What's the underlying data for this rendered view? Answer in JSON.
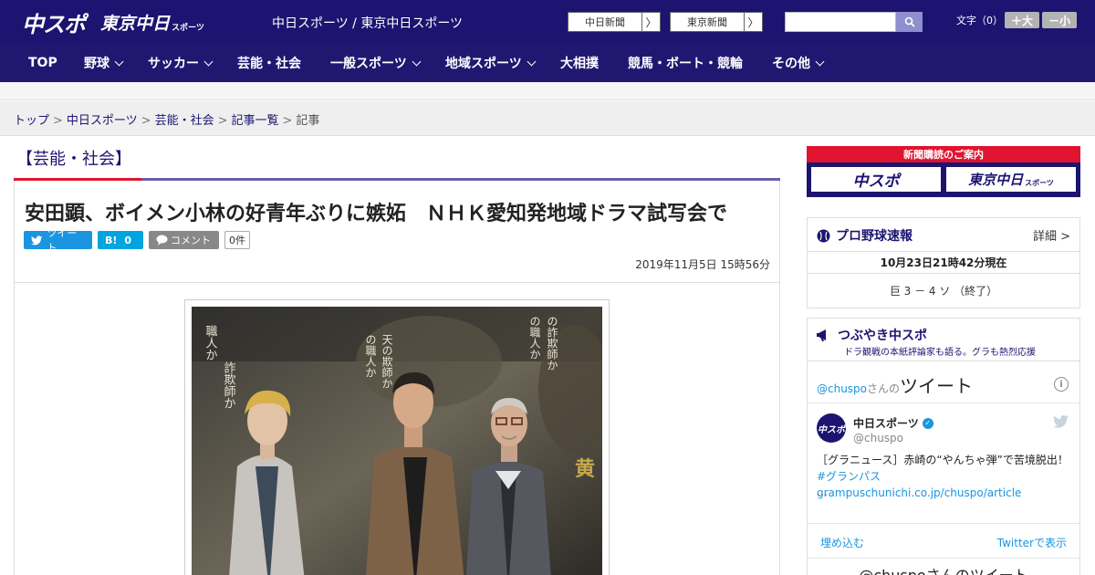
{
  "header": {
    "logo_main": "中スポ",
    "logo_tokyo": "東京中日",
    "logo_tokyo_small": "スポーツ",
    "site_name": "中日スポーツ / 東京中日スポーツ",
    "btn_chunichi": "中日新聞",
    "btn_tokyo": "東京新聞",
    "arrow": "〉",
    "font_size_label": "文字（0）",
    "font_plus": "＋大",
    "font_minus": "－小",
    "brand_color": "#1c1470",
    "accent_red": "#e0142e"
  },
  "nav": {
    "items": [
      {
        "label": "TOP",
        "has_dropdown": false
      },
      {
        "label": "野球",
        "has_dropdown": true
      },
      {
        "label": "サッカー",
        "has_dropdown": true
      },
      {
        "label": "芸能・社会",
        "has_dropdown": false
      },
      {
        "label": "一般スポーツ",
        "has_dropdown": true
      },
      {
        "label": "地域スポーツ",
        "has_dropdown": true
      },
      {
        "label": "大相撲",
        "has_dropdown": false
      },
      {
        "label": "競馬・ボート・競輪",
        "has_dropdown": false
      },
      {
        "label": "その他",
        "has_dropdown": true
      }
    ]
  },
  "breadcrumb": {
    "items": [
      "トップ",
      "中日スポーツ",
      "芸能・社会",
      "記事一覧"
    ],
    "current": "記事",
    "separator": ">"
  },
  "article": {
    "category": "【芸能・社会】",
    "headline": "安田顕、ボイメン小林の好青年ぶりに嫉妬　ＮＨＫ愛知発地域ドラマ試写会で",
    "tweet_label": "ツイート",
    "hatena_label": "B!",
    "hatena_count": "0",
    "comment_label": "コメント",
    "comment_count": "0件",
    "date": "2019年11月5日 15時56分"
  },
  "sidebar": {
    "subscription_title": "新聞購読のご案内",
    "sub_logo_1": "中スポ",
    "sub_logo_2": "東京中日",
    "sub_logo_2_small": "スポーツ",
    "baseball": {
      "title": "プロ野球速報",
      "more": "詳細 >",
      "time": "10月23日21時42分現在",
      "score": "巨 3 － 4 ソ （終了）"
    },
    "tweets": {
      "title": "つぶやき中スポ",
      "subtitle": "ドラ観戦の本紙評論家も語る。グラも熱烈応援",
      "head_handle": "@chuspo",
      "head_suffix": "さんの",
      "head_big": "ツイート",
      "info": "i",
      "avatar_text": "中スポ",
      "author": "中日スポーツ",
      "handle": "@chuspo",
      "text_plain": "［グラニュース］赤崎の“やんちゃ弾”で苦境脱出！",
      "text_link": "#グランパス grampuschunichi.co.jp/chuspo/article",
      "ellipsis": "…",
      "embed": "埋め込む",
      "view_on": "Twitterで表示",
      "footer": "@chuspoさんのツイート"
    }
  }
}
